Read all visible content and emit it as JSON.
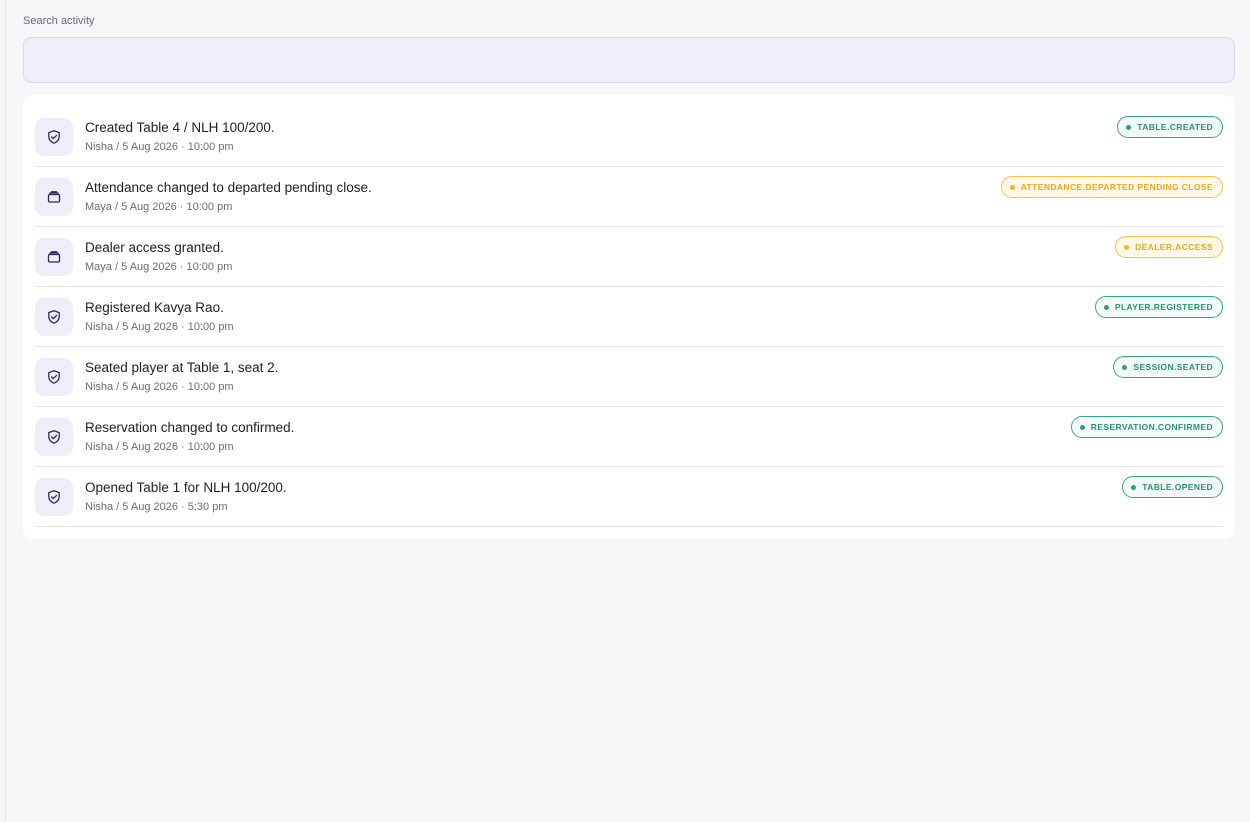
{
  "search": {
    "label": "Search activity",
    "value": "",
    "placeholder": ""
  },
  "activity": [
    {
      "icon": "shield-check-icon",
      "title": "Created Table 4 / NLH 100/200.",
      "meta": "Nisha / 5 Aug 2026 · 10:00 pm",
      "badge": "TABLE.CREATED",
      "tone": "green"
    },
    {
      "icon": "wallet-icon",
      "title": "Attendance changed to departed pending close.",
      "meta": "Maya / 5 Aug 2026 · 10:00 pm",
      "badge": "ATTENDANCE.DEPARTED PENDING CLOSE",
      "tone": "amber"
    },
    {
      "icon": "wallet-icon",
      "title": "Dealer access granted.",
      "meta": "Maya / 5 Aug 2026 · 10:00 pm",
      "badge": "DEALER.ACCESS",
      "tone": "amber"
    },
    {
      "icon": "shield-check-icon",
      "title": "Registered Kavya Rao.",
      "meta": "Nisha / 5 Aug 2026 · 10:00 pm",
      "badge": "PLAYER.REGISTERED",
      "tone": "green"
    },
    {
      "icon": "shield-check-icon",
      "title": "Seated player at Table 1, seat 2.",
      "meta": "Nisha / 5 Aug 2026 · 10:00 pm",
      "badge": "SESSION.SEATED",
      "tone": "green"
    },
    {
      "icon": "shield-check-icon",
      "title": "Reservation changed to confirmed.",
      "meta": "Nisha / 5 Aug 2026 · 10:00 pm",
      "badge": "RESERVATION.CONFIRMED",
      "tone": "green"
    },
    {
      "icon": "shield-check-icon",
      "title": "Opened Table 1 for NLH 100/200.",
      "meta": "Nisha / 5 Aug 2026 · 5:30 pm",
      "badge": "TABLE.OPENED",
      "tone": "green"
    }
  ],
  "colors": {
    "accent_green": "#2f8f76",
    "accent_amber": "#e3a92a",
    "icon_stroke": "#2b2a5a"
  }
}
